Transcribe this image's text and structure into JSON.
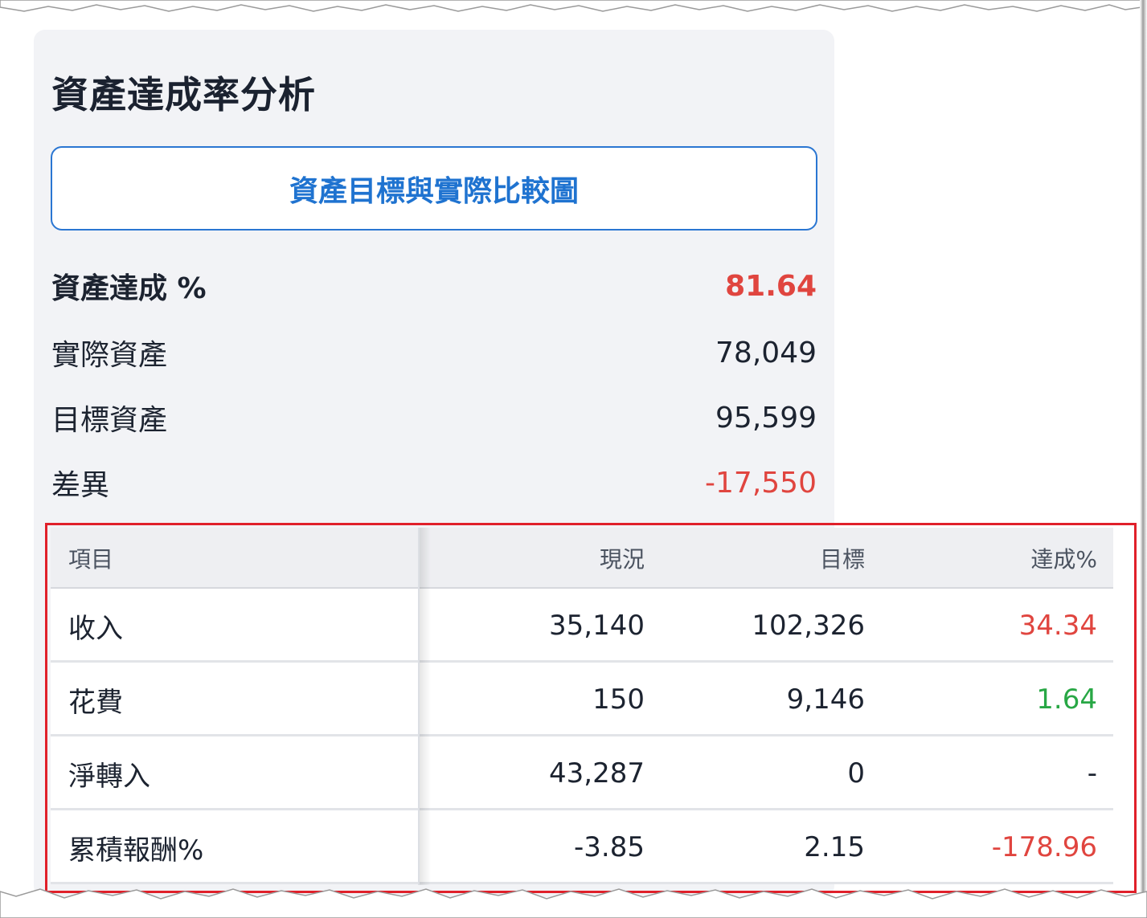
{
  "page": {
    "title": "資產達成率分析",
    "chart_button_label": "資產目標與實際比較圖"
  },
  "summary": {
    "achievement": {
      "label": "資產達成 %",
      "value": "81.64"
    },
    "actual": {
      "label": "實際資產",
      "value": "78,049"
    },
    "target": {
      "label": "目標資產",
      "value": "95,599"
    },
    "difference": {
      "label": "差異",
      "value": "-17,550"
    }
  },
  "table": {
    "headers": {
      "item": "項目",
      "current": "現況",
      "target": "目標",
      "achievement": "達成%"
    },
    "rows": [
      {
        "item": "收入",
        "current": "35,140",
        "target": "102,326",
        "achievement": "34.34",
        "status": "negative"
      },
      {
        "item": "花費",
        "current": "150",
        "target": "9,146",
        "achievement": "1.64",
        "status": "positive"
      },
      {
        "item": "淨轉入",
        "current": "43,287",
        "target": "0",
        "achievement": "-",
        "status": "neutral"
      },
      {
        "item": "累積報酬%",
        "current": "-3.85",
        "target": "2.15",
        "achievement": "-178.96",
        "status": "negative"
      }
    ]
  },
  "colors": {
    "accent": "#1f73d0",
    "negative": "#e0453f",
    "positive": "#28a745",
    "highlight_border": "#e0202a",
    "card_bg": "#f2f3f6"
  }
}
